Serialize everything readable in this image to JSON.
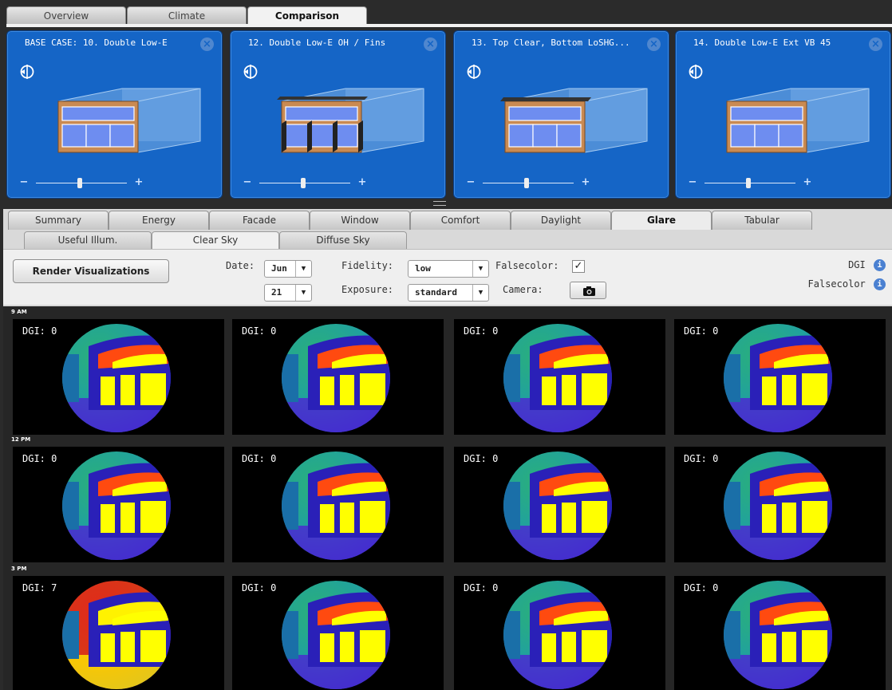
{
  "top_tabs": [
    {
      "label": "Overview",
      "active": false
    },
    {
      "label": "Climate",
      "active": false
    },
    {
      "label": "Comparison",
      "active": true
    }
  ],
  "cards": [
    {
      "title": "BASE CASE: 10. Double Low-E",
      "shading": "none"
    },
    {
      "title": "12. Double Low-E OH / Fins",
      "shading": "fins"
    },
    {
      "title": "13. Top Clear, Bottom LoSHG...",
      "shading": "overhang"
    },
    {
      "title": "14. Double Low-E Ext VB 45",
      "shading": "none"
    }
  ],
  "card_controls": {
    "close_icon": "close-icon",
    "compass_icon": "compass-icon",
    "zoom_minus": "−",
    "zoom_plus": "+"
  },
  "tabs": [
    {
      "label": "Summary",
      "active": false
    },
    {
      "label": "Energy",
      "active": false
    },
    {
      "label": "Facade",
      "active": false
    },
    {
      "label": "Window",
      "active": false
    },
    {
      "label": "Comfort",
      "active": false
    },
    {
      "label": "Daylight",
      "active": false
    },
    {
      "label": "Glare",
      "active": true
    },
    {
      "label": "Tabular",
      "active": false
    }
  ],
  "subtabs": [
    {
      "label": "Useful Illum.",
      "active": false
    },
    {
      "label": "Clear Sky",
      "active": true
    },
    {
      "label": "Diffuse Sky",
      "active": false
    }
  ],
  "controls": {
    "render_button": "Render Visualizations",
    "date_label": "Date:",
    "month": "Jun",
    "day": "21",
    "fidelity_label": "Fidelity:",
    "fidelity": "low",
    "exposure_label": "Exposure:",
    "exposure": "standard",
    "falsecolor_label": "Falsecolor:",
    "falsecolor_checked": true,
    "check_mark": "✓",
    "camera_label": "Camera:",
    "dgi_info": "DGI",
    "falsecolor_info": "Falsecolor",
    "info_glyph": "i"
  },
  "rows": [
    {
      "time": "9 AM",
      "dgi": [
        "DGI: 0",
        "DGI: 0",
        "DGI: 0",
        "DGI: 0"
      ]
    },
    {
      "time": "12 PM",
      "dgi": [
        "DGI: 0",
        "DGI: 0",
        "DGI: 0",
        "DGI: 0"
      ]
    },
    {
      "time": "3 PM",
      "dgi": [
        "DGI: 7",
        "DGI: 0",
        "DGI: 0",
        "DGI: 0"
      ]
    }
  ],
  "colors": {
    "card_blue": "#1565c6",
    "glare_yellow": "#ffff00",
    "glare_red": "#e0201a",
    "glare_blue": "#2a2ad0",
    "glare_purple": "#5a2aa8",
    "glare_green": "#2aa880"
  }
}
